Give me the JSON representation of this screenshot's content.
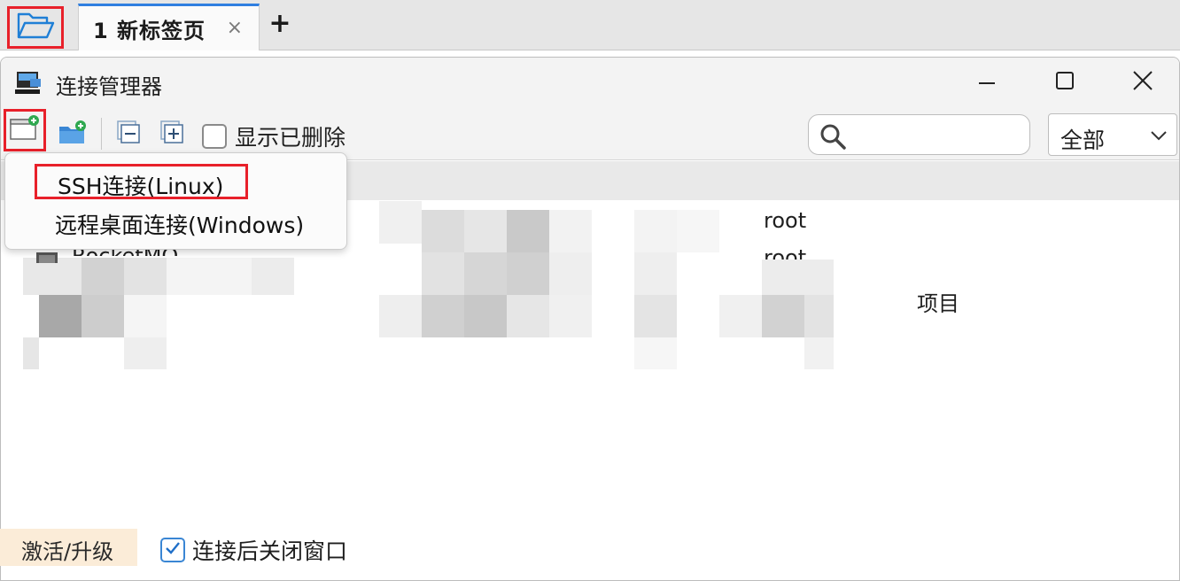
{
  "tabbar": {
    "tab_label": "1 新标签页",
    "close_glyph": "×",
    "new_tab_glyph": "+"
  },
  "dialog": {
    "title": "连接管理器",
    "show_deleted_label": "显示已删除",
    "show_deleted_checked": false,
    "search_value": "",
    "filter_value": "全部"
  },
  "menu": {
    "items": [
      {
        "label": "SSH连接(Linux)",
        "highlighted": true
      },
      {
        "label": "远程桌面连接(Windows)",
        "highlighted": false
      }
    ]
  },
  "list": {
    "visible_text": {
      "row1_user": "root",
      "row2_name": "RocketMQ",
      "row2_user": "root",
      "group_label": "项目"
    }
  },
  "footer": {
    "activate_label": "激活/升级",
    "close_after_connect_label": "连接后关闭窗口",
    "close_after_connect_checked": true
  },
  "colors": {
    "highlight_border": "#e8202a",
    "active_tab_accent": "#2f7fe0",
    "activate_bg": "#fbecd8"
  },
  "icons": [
    "folder-open-icon",
    "monitor-icon",
    "minimize-icon",
    "maximize-icon",
    "close-icon",
    "new-connection-icon",
    "new-folder-icon",
    "collapse-icon",
    "expand-icon",
    "search-icon",
    "chevron-down-icon",
    "checkmark-icon"
  ]
}
